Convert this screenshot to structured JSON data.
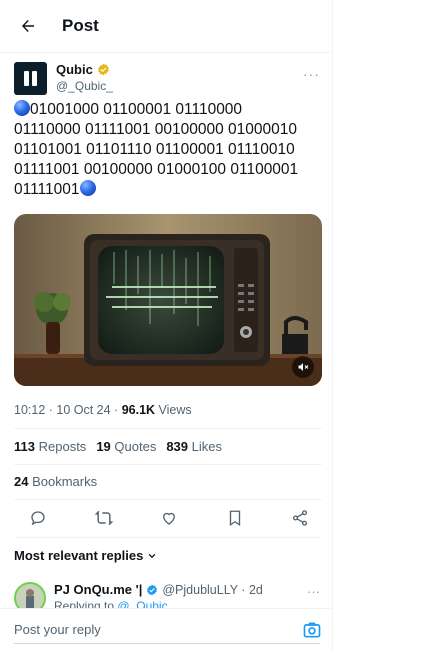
{
  "header": {
    "title": "Post"
  },
  "author": {
    "name": "Qubic",
    "handle": "@_Qubic_"
  },
  "tweet": {
    "lines": [
      "01001000 01100001 01110000",
      "01110000 01111001 00100000 01000010",
      "01101001 01101110 01100001 01110010",
      "01111001 00100000 01000100 01100001",
      "01111001"
    ]
  },
  "meta": {
    "time": "10:12 · 10 Oct 24 · ",
    "views_count": "96.1K",
    "views_label": " Views"
  },
  "stats": {
    "reposts_count": "113",
    "reposts_label": "Reposts",
    "quotes_count": "19",
    "quotes_label": "Quotes",
    "likes_count": "839",
    "likes_label": "Likes"
  },
  "bookmarks": {
    "count": "24",
    "label": "Bookmarks"
  },
  "replies": {
    "sort_label": "Most relevant replies",
    "items": [
      {
        "name": "PJ OnQu.me '|",
        "handle": "@PjdubluLLY · 2d",
        "replying_prefix": "Replying to ",
        "replying_to": "@_Qubic_"
      }
    ]
  },
  "composer": {
    "placeholder": "Post your reply"
  },
  "colors": {
    "accent": "#1d9bf0",
    "verified_gold": "#e2b719",
    "text": "#0f1419",
    "muted": "#536471"
  },
  "icons": [
    "back-arrow-icon",
    "verified-gold-icon",
    "more-icon",
    "mute-icon",
    "reply-icon",
    "repost-icon",
    "like-icon",
    "bookmark-icon",
    "share-icon",
    "chevron-down-icon",
    "verified-blue-icon",
    "camera-icon"
  ]
}
